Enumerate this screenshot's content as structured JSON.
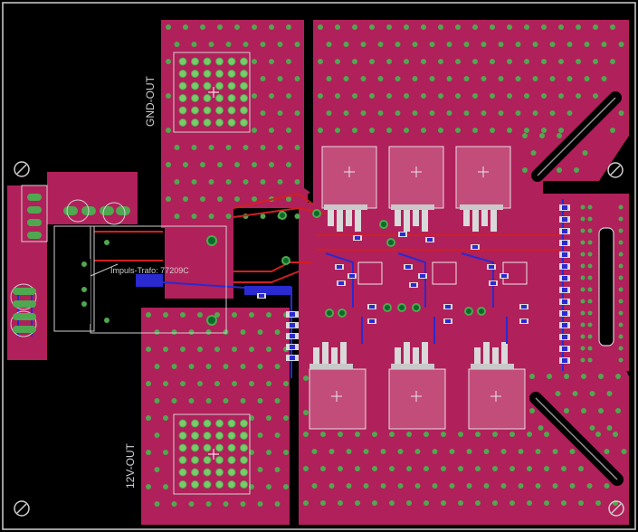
{
  "board": {
    "background": "#000000",
    "copper_color": "#b0205a",
    "pad_color": "#4fa84f",
    "outline_color": "#d0d0d0",
    "trace_red": "#d02020",
    "trace_blue": "#2a2ad0"
  },
  "labels": {
    "gnd_out": "GND-OUT",
    "v12_out": "12V-OUT",
    "transformer": "Impuls-Trafo: 77209C"
  }
}
